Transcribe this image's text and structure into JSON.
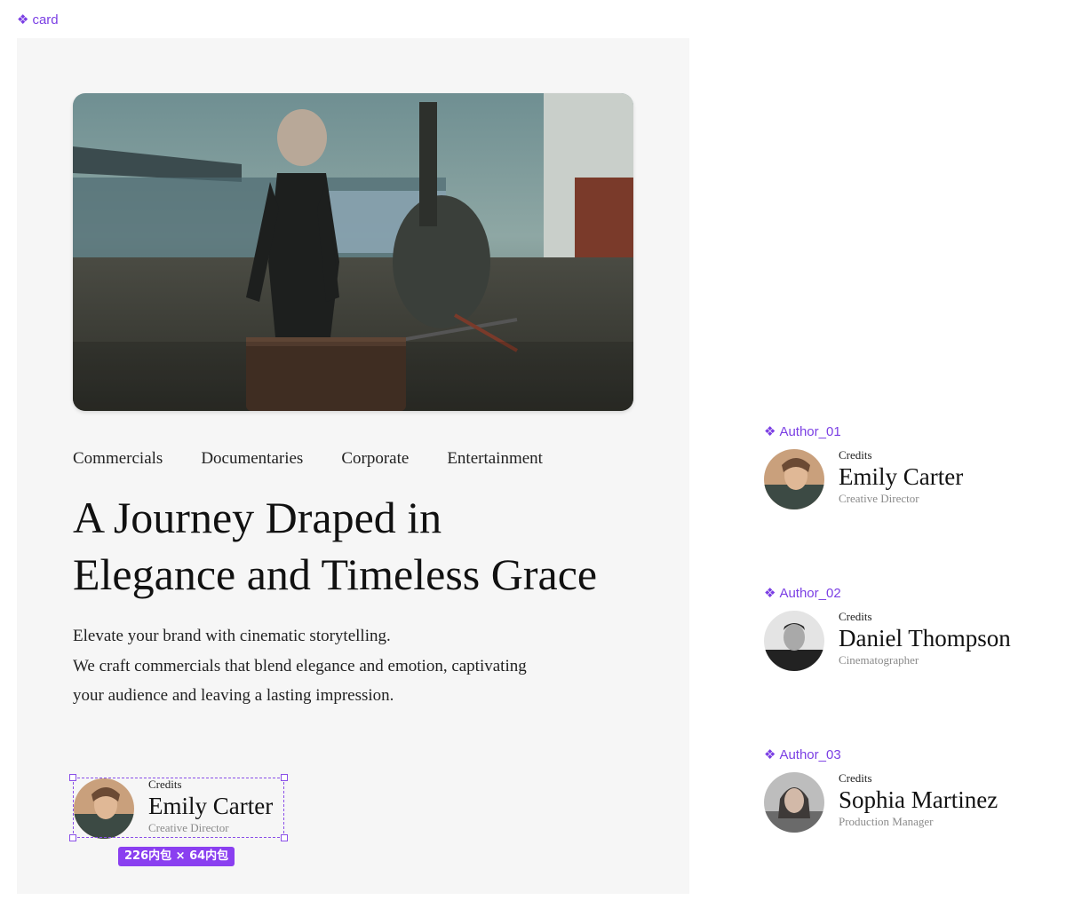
{
  "card_label": "card",
  "card": {
    "tags": [
      "Commercials",
      "Documentaries",
      "Corporate",
      "Entertainment"
    ],
    "headline_lines": [
      "A Journey Draped in",
      "Elegance and Timeless Grace"
    ],
    "description_lines": [
      "Elevate your brand with cinematic storytelling.",
      " We craft commercials that blend elegance and emotion, captivating",
      "your audience and leaving a lasting impression."
    ],
    "author": {
      "credits": "Credits",
      "name": "Emily Carter",
      "role": "Creative Director"
    }
  },
  "selection": {
    "size_badge": "226内包 × 64内包"
  },
  "components": [
    {
      "label": "Author_01",
      "credits": "Credits",
      "name": "Emily Carter",
      "role": "Creative Director"
    },
    {
      "label": "Author_02",
      "credits": "Credits",
      "name": "Daniel Thompson",
      "role": "Cinematographer"
    },
    {
      "label": "Author_03",
      "credits": "Credits",
      "name": "Sophia Martinez",
      "role": "Production Manager"
    }
  ],
  "colors": {
    "component_accent": "#7b3fe4",
    "card_background": "#f6f6f6"
  },
  "icons": {
    "component": "component-diamond-icon"
  }
}
